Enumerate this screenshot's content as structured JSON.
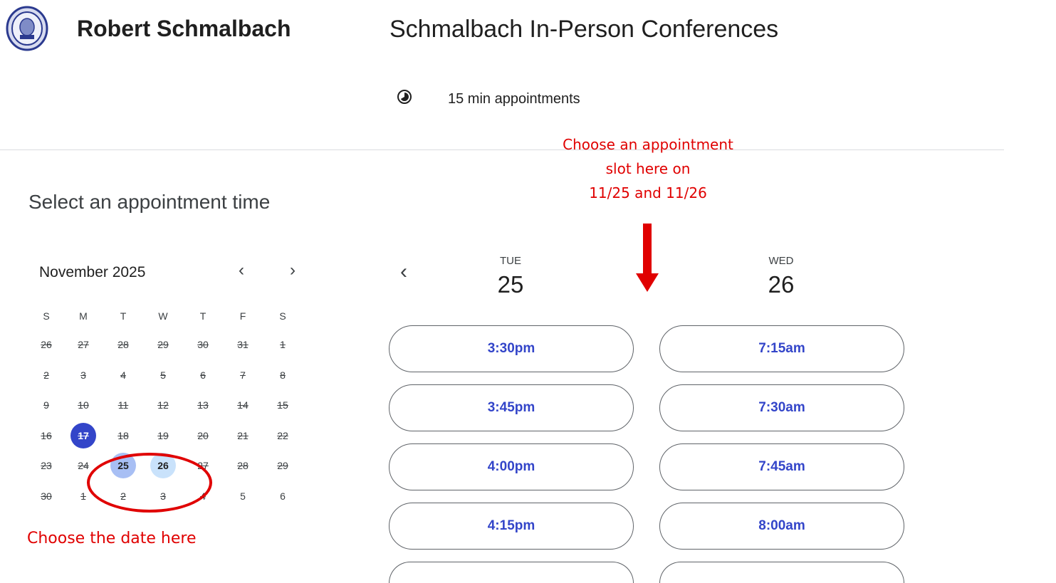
{
  "header": {
    "owner_name": "Robert Schmalbach",
    "page_title": "Schmalbach In-Person Conferences",
    "duration": "15 min appointments"
  },
  "select_title": "Select an appointment time",
  "mini_calendar": {
    "month_label": "November 2025",
    "prev_label": "‹",
    "next_label": "›",
    "weekday_headers": [
      "S",
      "M",
      "T",
      "W",
      "T",
      "F",
      "S"
    ],
    "weeks": [
      [
        "26",
        "27",
        "28",
        "29",
        "30",
        "31",
        "1"
      ],
      [
        "2",
        "3",
        "4",
        "5",
        "6",
        "7",
        "8"
      ],
      [
        "9",
        "10",
        "11",
        "12",
        "13",
        "14",
        "15"
      ],
      [
        "16",
        "17",
        "18",
        "19",
        "20",
        "21",
        "22"
      ],
      [
        "23",
        "24",
        "25",
        "26",
        "27",
        "28",
        "29"
      ],
      [
        "30",
        "1",
        "2",
        "3",
        "4",
        "5",
        "6"
      ]
    ],
    "today": "17",
    "available": [
      "25",
      "26"
    ],
    "colors": {
      "today": "#3345c9",
      "day_25": "#a8bff4",
      "day_26": "#c9e2fb"
    }
  },
  "schedule": {
    "prev_label": "‹",
    "days": [
      {
        "dow": "TUE",
        "date": "25",
        "slots": [
          "3:30pm",
          "3:45pm",
          "4:00pm",
          "4:15pm"
        ]
      },
      {
        "dow": "WED",
        "date": "26",
        "slots": [
          "7:15am",
          "7:30am",
          "7:45am",
          "8:00am"
        ]
      }
    ]
  },
  "annotations": {
    "slot_note": [
      "Choose an appointment",
      "slot here on",
      "11/25 and 11/26"
    ],
    "date_note": "Choose the date here",
    "color": "#e00000"
  },
  "icons": {
    "duration": "clock-icon",
    "logo": "seal-logo"
  }
}
